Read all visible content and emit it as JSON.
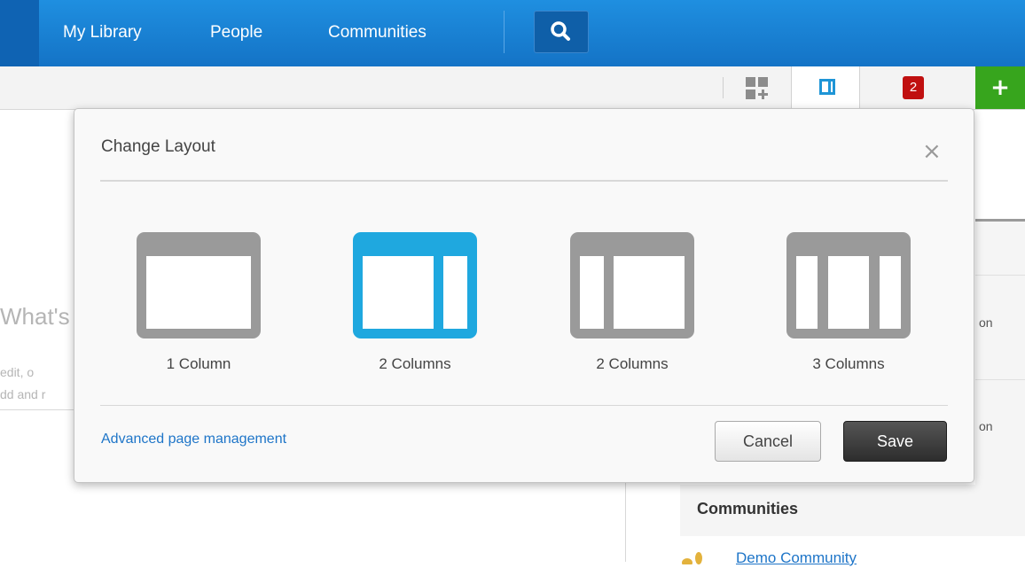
{
  "nav": {
    "items": [
      {
        "label": "My Library"
      },
      {
        "label": "People"
      },
      {
        "label": "Communities"
      }
    ],
    "search_icon": "search-icon"
  },
  "toolbar": {
    "widgets_icon": "add-widget-icon",
    "layout_icon": "layout-icon",
    "notification_count": "2",
    "add_icon": "plus-icon",
    "add_label": "+"
  },
  "background": {
    "whats_text": "What's",
    "edit_line1": " edit, o",
    "edit_line2": "dd and r",
    "right_text1": "on",
    "right_text2": "on",
    "communities_title": "Communities",
    "demo_link": "Demo Community"
  },
  "dialog": {
    "title": "Change Layout",
    "close_label": "×",
    "options": [
      {
        "label": "1 Column",
        "selected": false
      },
      {
        "label": "2 Columns",
        "selected": true
      },
      {
        "label": "2 Columns",
        "selected": false
      },
      {
        "label": "3 Columns",
        "selected": false
      }
    ],
    "advanced_link": "Advanced page management",
    "cancel_label": "Cancel",
    "save_label": "Save"
  },
  "colors": {
    "nav_blue": "#1a82d6",
    "selected_layout": "#1fa8df",
    "unselected_layout": "#9a9a9a",
    "link": "#1e75c8",
    "notification": "#c01010",
    "add_green": "#37a51d"
  }
}
